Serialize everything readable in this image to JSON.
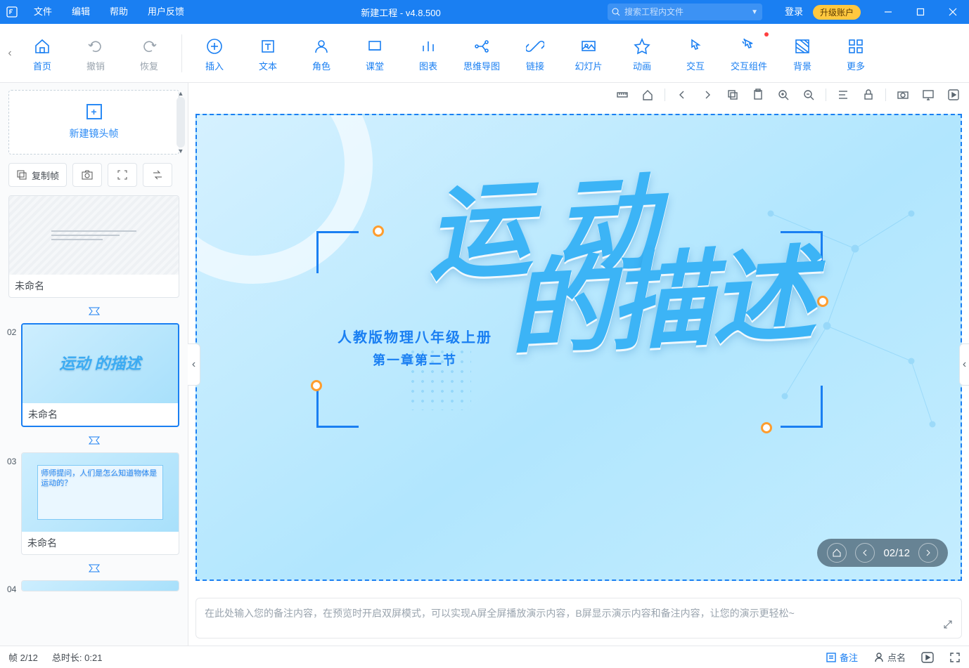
{
  "titlebar": {
    "menus": {
      "file": "文件",
      "edit": "编辑",
      "help": "帮助",
      "feedback": "用户反馈"
    },
    "title": "新建工程 - v4.8.500",
    "search_placeholder": "搜索工程内文件",
    "login": "登录",
    "upgrade": "升级账户"
  },
  "toolbar": {
    "home": "首页",
    "undo": "撤销",
    "redo": "恢复",
    "insert": "插入",
    "text": "文本",
    "role": "角色",
    "class": "课堂",
    "chart": "图表",
    "mindmap": "思维导图",
    "link": "链接",
    "slide": "幻灯片",
    "animation": "动画",
    "interact": "交互",
    "interact_widget": "交互组件",
    "background": "背景",
    "more": "更多"
  },
  "side": {
    "new_frame": "新建镜头帧",
    "copy_frame": "复制帧",
    "thumbs": [
      {
        "num": "",
        "title": "未命名"
      },
      {
        "num": "02",
        "title": "未命名",
        "selected": true
      },
      {
        "num": "03",
        "title": "未命名"
      },
      {
        "num": "04",
        "title": ""
      }
    ]
  },
  "slide": {
    "subtitle1": "人教版物理八年级上册",
    "subtitle2": "第一章第二节",
    "title_line1": "运 动",
    "title_line2": "的描述",
    "thumb_text": "运动\n的描述",
    "nav_counter": "02/12"
  },
  "notes": {
    "placeholder": "在此处输入您的备注内容，在预览时开启双屏模式，可以实现A屏全屏播放演示内容，B屏显示演示内容和备注内容，让您的演示更轻松~"
  },
  "status": {
    "frame_label": "帧 2/12",
    "duration_label": "总时长: 0:21",
    "notes_btn": "备注",
    "roll_btn": "点名"
  }
}
